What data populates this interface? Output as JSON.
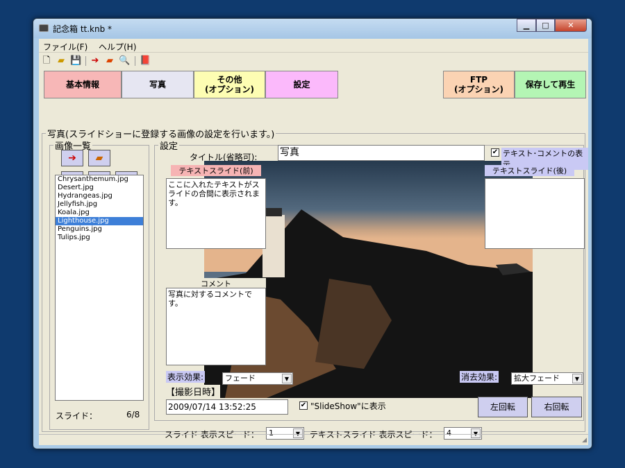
{
  "window": {
    "title": "記念箱 tt.knb *",
    "controls": {
      "minimize": "▁",
      "maximize": "□",
      "close": "✕"
    }
  },
  "menu": [
    "ファイル(F)",
    "ヘルプ(H)"
  ],
  "toolbar_icons": [
    "new-file-icon",
    "open-folder-icon",
    "save-icon",
    "export-icon",
    "open-icon",
    "search-icon",
    "book-icon"
  ],
  "tabs": {
    "basic": "基本情報",
    "photo": "写真",
    "other": "その他\n(オプション)",
    "settings": "設定",
    "ftp": "FTP\n(オプション)",
    "save_play": "保存して再生"
  },
  "colors": {
    "basic": "#f7b7b7",
    "photo_active": "#e6e6f2",
    "other": "#fdfdb3",
    "settings": "#fbb9fb",
    "ftp": "#fbd3b3",
    "save_play": "#b4f5b4",
    "label_pink": "#f6b4b4",
    "label_lav": "#c9c9f4"
  },
  "photo_section": {
    "header": "写真(スライドショーに登録する画像の設定を行います。)",
    "image_list": {
      "title": "画像一覧",
      "files": [
        "Chrysanthemum.jpg",
        "Desert.jpg",
        "Hydrangeas.jpg",
        "Jellyfish.jpg",
        "Koala.jpg",
        "Lighthouse.jpg",
        "Penguins.jpg",
        "Tulips.jpg"
      ],
      "selected_index": 5,
      "buttons": {
        "up": "↑",
        "down": "↓",
        "delete": "×"
      },
      "slide_label": "スライド：",
      "slide_count": "6/8"
    },
    "settings": {
      "title": "設定",
      "title_label": "タイトル(省略可):",
      "title_value": "写真",
      "show_text_comment_label": "テキスト･コメントの表示",
      "show_text_comment_checked": true,
      "text_slide_before_label": "テキストスライド(前)",
      "text_slide_before_value": "ここに入れたテキストがスライドの合間に表示されます。",
      "text_slide_after_label": "テキストスライド(後)",
      "text_slide_after_value": "",
      "comment_label": "コメント",
      "comment_value": "写真に対するコメントです。",
      "display_effect_label": "表示効果:",
      "display_effect_value": "フェード",
      "vanish_effect_label": "消去効果:",
      "vanish_effect_value": "拡大フェード",
      "shot_date_label": "【撮影日時】",
      "shot_date_value": "2009/07/14 13:52:25",
      "slideshow_show_label": "\"SlideShow\"に表示",
      "slideshow_show_checked": true,
      "rotate_left": "左回転",
      "rotate_right": "右回転"
    },
    "speed": {
      "slide_label": "スライド 表示スピード：",
      "slide_value": "1",
      "text_label": "テキストスライド 表示スピード：",
      "text_value": "4"
    }
  }
}
